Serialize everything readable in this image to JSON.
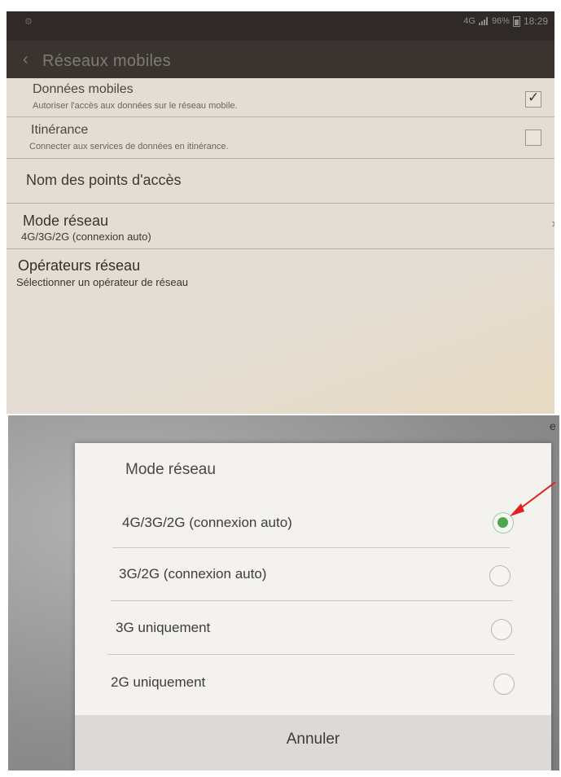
{
  "settings_screen": {
    "status_bar": {
      "network": "4G",
      "battery": "96%",
      "time": "18:29"
    },
    "title": "Réseaux mobiles",
    "back_icon": "chevron-left-icon",
    "items": [
      {
        "title": "Données mobiles",
        "subtitle": "Autoriser l'accès aux données sur le réseau mobile.",
        "checked": true
      },
      {
        "title": "Itinérance",
        "subtitle": "Connecter aux services de données en itinérance.",
        "checked": false
      },
      {
        "title": "Nom des points d'accès"
      },
      {
        "title": "Mode réseau",
        "subtitle": "4G/3G/2G (connexion auto)"
      },
      {
        "title": "Opérateurs réseau",
        "subtitle": "Sélectionner un opérateur de réseau"
      }
    ]
  },
  "dialog": {
    "title": "Mode réseau",
    "options": [
      {
        "label": "4G/3G/2G (connexion auto)",
        "selected": true
      },
      {
        "label": "3G/2G (connexion auto)",
        "selected": false
      },
      {
        "label": "3G uniquement",
        "selected": false
      },
      {
        "label": "2G uniquement",
        "selected": false
      }
    ],
    "cancel_label": "Annuler"
  },
  "annotation": {
    "arrow_color": "#e02020"
  },
  "cropped_edge_text": "e",
  "colors": {
    "radio_selected": "#4fa64f",
    "status_bar": "#2f2a27"
  }
}
